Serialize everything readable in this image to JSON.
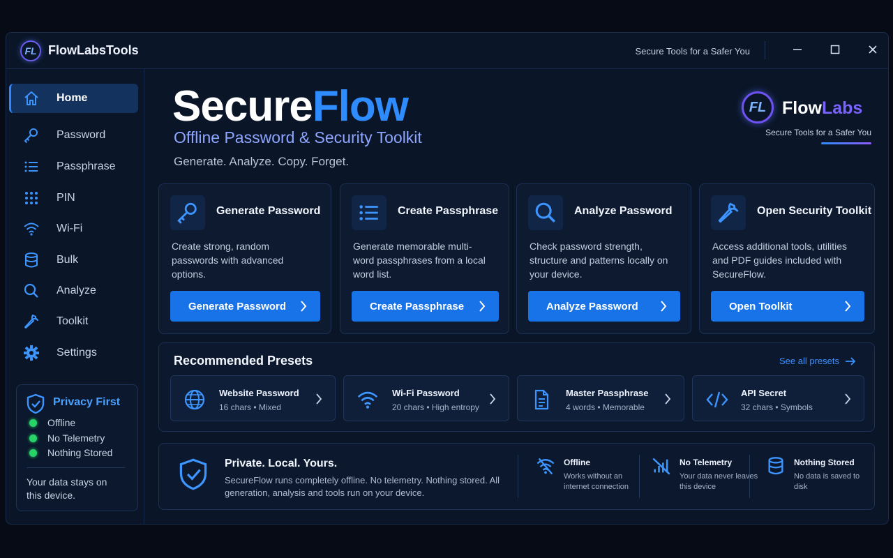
{
  "titlebar": {
    "logo_text": "FL",
    "app_name": "FlowLabsTools",
    "tagline": "Secure Tools for a Safer You",
    "minimize": "—",
    "maximize": "☐",
    "close": "✕"
  },
  "sidebar": {
    "items": [
      {
        "label": "Home",
        "icon": "home-icon",
        "active": true
      },
      {
        "label": "Password",
        "icon": "key-icon"
      },
      {
        "label": "Passphrase",
        "icon": "list-icon"
      },
      {
        "label": "PIN",
        "icon": "keypad-icon"
      },
      {
        "label": "Wi-Fi",
        "icon": "wifi-icon"
      },
      {
        "label": "Bulk",
        "icon": "database-icon"
      },
      {
        "label": "Analyze",
        "icon": "search-icon"
      },
      {
        "label": "Toolkit",
        "icon": "wrench-icon"
      },
      {
        "label": "Settings",
        "icon": "gear-icon"
      }
    ],
    "privacy": {
      "title": "Privacy First",
      "items": [
        "Offline",
        "No Telemetry",
        "Nothing Stored"
      ],
      "note": "Your data stays on this device."
    }
  },
  "hero": {
    "title_white": "Secure",
    "title_blue": "Flow",
    "subtitle": "Offline Password & Security Toolkit",
    "tagline": "Generate. Analyze. Copy. Forget."
  },
  "brand_logo": {
    "mark": "FL",
    "name_a": "Flow",
    "name_b": "Labs",
    "tagline": "Secure Tools for a Safer You"
  },
  "cards": [
    {
      "title": "Generate Password",
      "desc": "Create strong, random passwords with advanced options.",
      "button": "Generate Password",
      "icon": "key-icon"
    },
    {
      "title": "Create Passphrase",
      "desc": "Generate memorable multi-word passphrases from a local word list.",
      "button": "Create Passphrase",
      "icon": "list-icon"
    },
    {
      "title": "Analyze Password",
      "desc": "Check password strength, structure and patterns locally on your device.",
      "button": "Analyze Password",
      "icon": "search-icon"
    },
    {
      "title": "Open Security Toolkit",
      "desc": "Access additional tools, utilities and PDF guides included with SecureFlow.",
      "button": "Open Toolkit",
      "icon": "wrench-icon"
    }
  ],
  "presets": {
    "title": "Recommended Presets",
    "see_all": "See all presets",
    "items": [
      {
        "name": "Website Password",
        "meta": "16 chars • Mixed",
        "icon": "globe-icon"
      },
      {
        "name": "Wi-Fi Password",
        "meta": "20 chars • High entropy",
        "icon": "wifi-icon"
      },
      {
        "name": "Master Passphrase",
        "meta": "4 words • Memorable",
        "icon": "document-icon"
      },
      {
        "name": "API Secret",
        "meta": "32 chars • Symbols",
        "icon": "code-icon"
      }
    ]
  },
  "info": {
    "title": "Private. Local. Yours.",
    "text": "SecureFlow runs completely offline. No telemetry. Nothing stored. All generation, analysis and tools run on your device.",
    "items": [
      {
        "title": "Offline",
        "text": "Works without an internet connection",
        "icon": "wifi-off-icon"
      },
      {
        "title": "No Telemetry",
        "text": "Your data never leaves this device",
        "icon": "no-signal-icon"
      },
      {
        "title": "Nothing Stored",
        "text": "No data is saved to disk",
        "icon": "database-icon"
      }
    ]
  },
  "colors": {
    "accent": "#1872e8",
    "brand_blue": "#2f8cff",
    "brand_purple": "#7b63ff",
    "status_green": "#28d46a",
    "background": "#0a1527"
  }
}
